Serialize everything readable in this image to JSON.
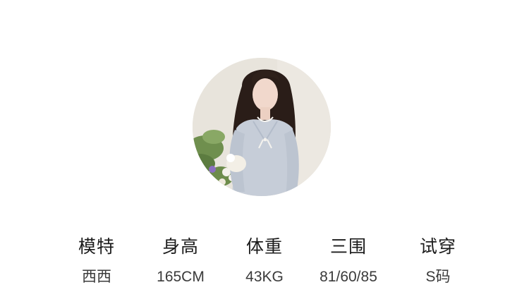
{
  "model_card": {
    "photo_alt": "model-avatar",
    "specs": [
      {
        "label": "模特",
        "value": "西西"
      },
      {
        "label": "身高",
        "value": "165CM"
      },
      {
        "label": "体重",
        "value": "43KG"
      },
      {
        "label": "三围",
        "value": "81/60/85"
      },
      {
        "label": "试穿",
        "value": "S码"
      }
    ]
  },
  "colors": {
    "background": "#ffffff",
    "label_text": "#1b1b1b",
    "value_text": "#3a3a3a",
    "cardigan": "#c6cdd8"
  }
}
